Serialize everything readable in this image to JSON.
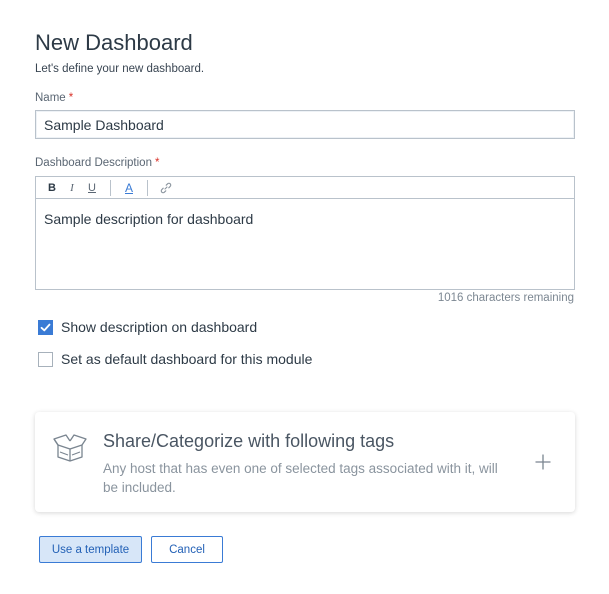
{
  "header": {
    "title": "New Dashboard",
    "subtitle": "Let's define your new dashboard."
  },
  "name_field": {
    "label": "Name",
    "required_mark": "*",
    "value": "Sample Dashboard"
  },
  "description_field": {
    "label": "Dashboard Description",
    "required_mark": "*",
    "toolbar": {
      "bold": "B",
      "italic": "I",
      "underline": "U",
      "text_color": "A",
      "link_icon": "link-icon"
    },
    "value": "Sample description for dashboard",
    "chars_remaining": "1016 characters remaining"
  },
  "options": {
    "show_description": {
      "label": "Show description on dashboard",
      "checked": true
    },
    "set_default": {
      "label": "Set as default dashboard for this module",
      "checked": false
    }
  },
  "tags_card": {
    "icon": "open-box-icon",
    "title": "Share/Categorize with following tags",
    "description": "Any host that has even one of selected tags associated with it, will be included.",
    "add_icon": "plus-icon"
  },
  "buttons": {
    "use_template": "Use a template",
    "cancel": "Cancel"
  },
  "colors": {
    "accent": "#3a7bd5",
    "required": "#d9342b",
    "template_button_bg": "#d7e6f8"
  }
}
